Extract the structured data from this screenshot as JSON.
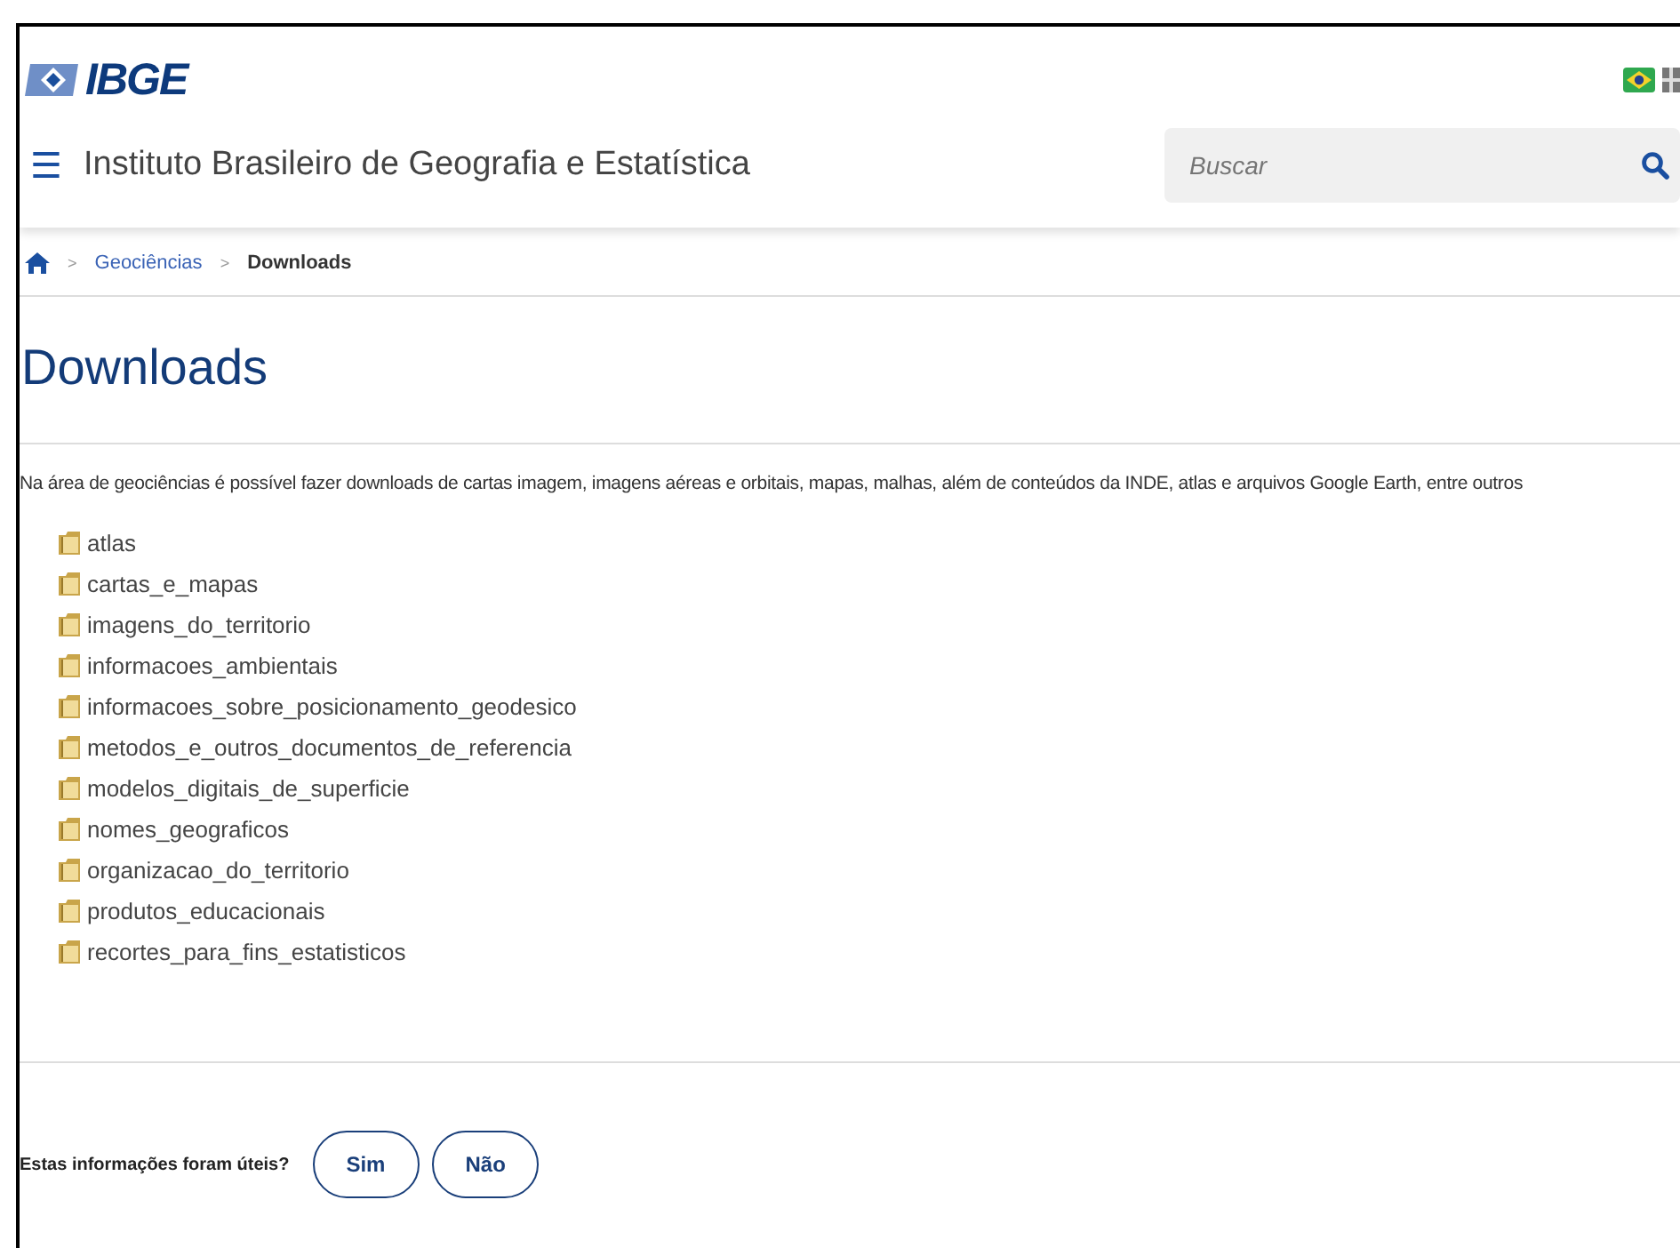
{
  "header": {
    "logo": "IBGE",
    "menu_icon": "☰",
    "title": "Instituto Brasileiro de Geografia e Estatística",
    "search": {
      "placeholder": "Buscar"
    }
  },
  "breadcrumb": [
    {
      "label": "Geociências",
      "kind": "link"
    },
    {
      "label": "Downloads",
      "kind": "current"
    }
  ],
  "breadcrumb_separator": ">",
  "heading": "Downloads",
  "description": "Na área de geociências é possível fazer downloads de cartas imagem, imagens aéreas e orbitais, mapas, malhas, além de conteúdos da INDE, atlas e arquivos Google Earth, entre outros",
  "folders": [
    "atlas",
    "cartas_e_mapas",
    "imagens_do_territorio",
    "informacoes_ambientais",
    "informacoes_sobre_posicionamento_geodesico",
    "metodos_e_outros_documentos_de_referencia",
    "modelos_digitais_de_superficie",
    "nomes_geograficos",
    "organizacao_do_territorio",
    "produtos_educacionais",
    "recortes_para_fins_estatisticos"
  ],
  "feedback": {
    "question": "Estas informações foram úteis?",
    "buttons": [
      "Sim",
      "Não"
    ]
  }
}
